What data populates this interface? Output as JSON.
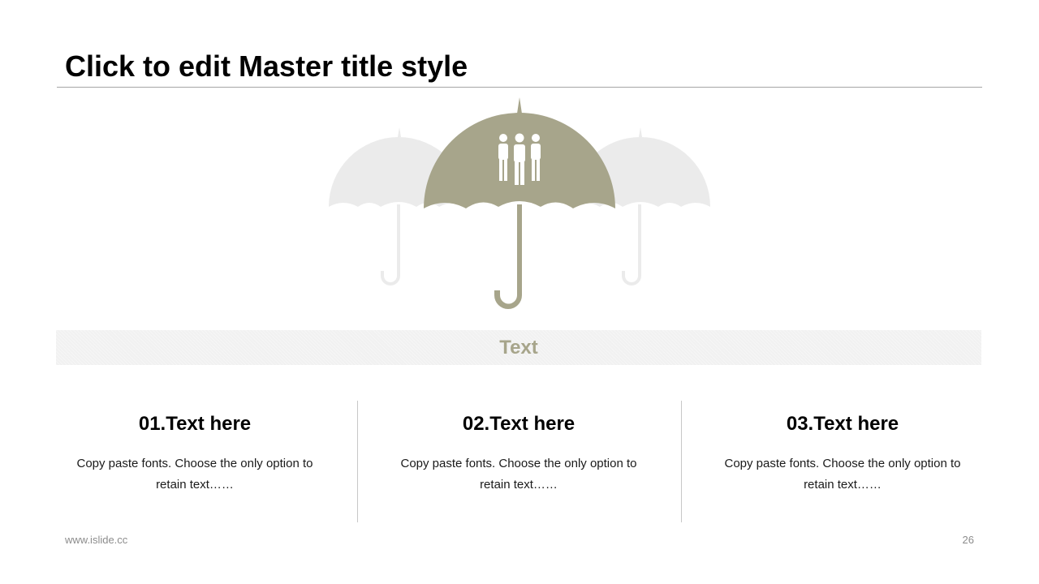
{
  "slide": {
    "title": "Click to edit Master title style",
    "banner_text": "Text",
    "columns": [
      {
        "heading": "01.Text here",
        "body": "Copy paste fonts. Choose the only option to retain text……"
      },
      {
        "heading": "02.Text here",
        "body": "Copy paste fonts. Choose the only option to retain text……"
      },
      {
        "heading": "03.Text here",
        "body": "Copy paste fonts. Choose the only option to retain text……"
      }
    ]
  },
  "footer": {
    "url": "www.islide.cc",
    "page_number": "26"
  },
  "icons": {
    "center": "umbrella-icon",
    "side": "umbrella-icon",
    "inside_umbrella": "people-group-icon"
  },
  "colors": {
    "accent": "#a7a58b",
    "faded_umbrella": "#ebebeb",
    "banner_bg": "#f1f1f1",
    "divider": "#c8c8c8",
    "title_rule": "#a6a6a6"
  }
}
